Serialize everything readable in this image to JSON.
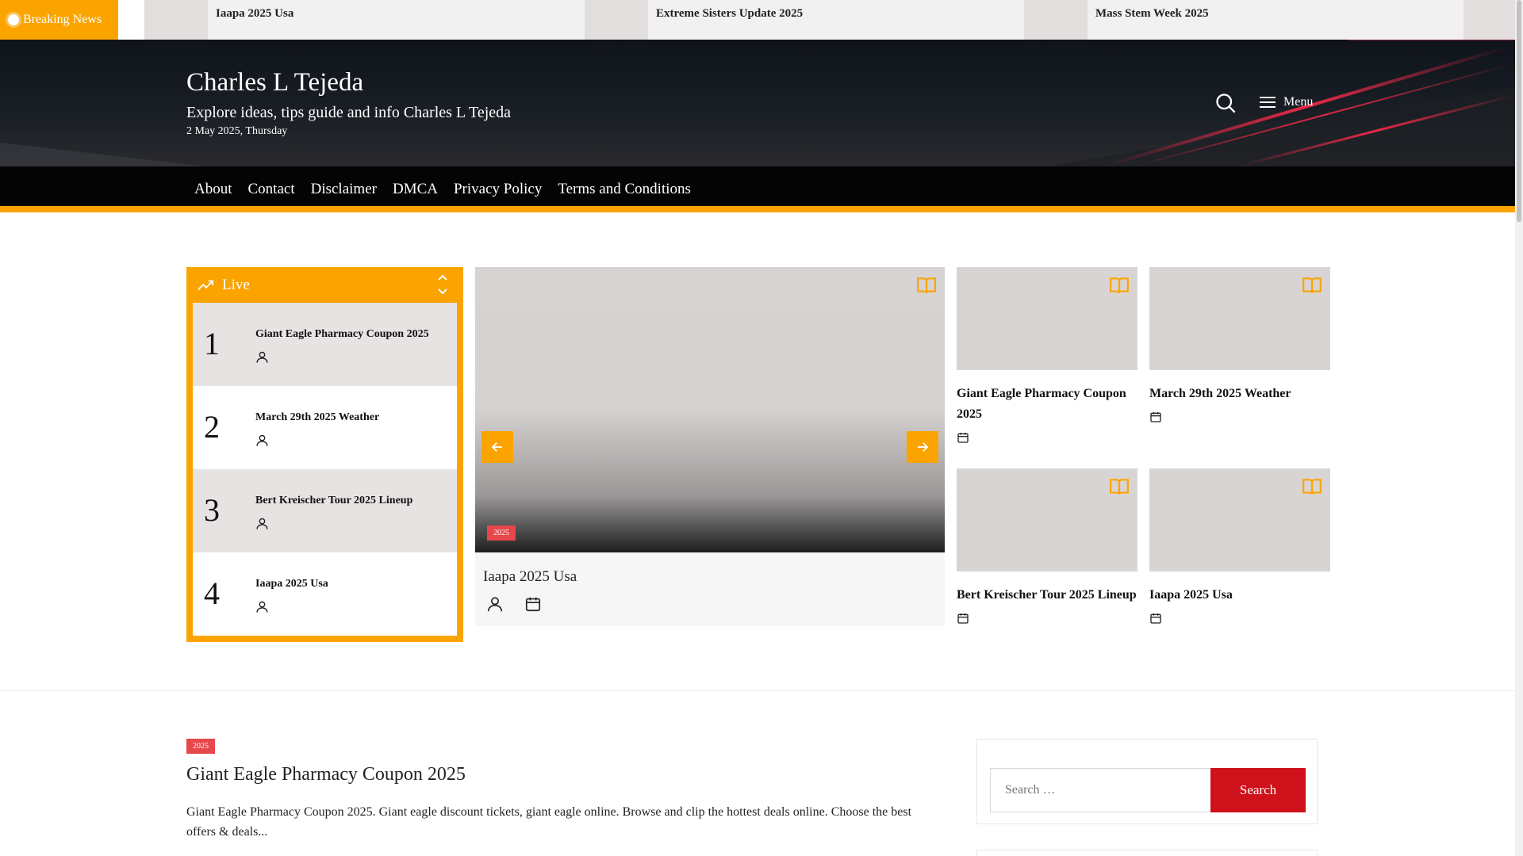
{
  "ticker": {
    "label": "Breaking News",
    "items": [
      "Iaapa 2025 Usa",
      "Extreme Sisters Update 2025",
      "Mass Stem Week 2025"
    ]
  },
  "header": {
    "site_title": "Charles L Tejeda",
    "tagline": "Explore ideas, tips guide and info Charles L Tejeda",
    "date": "2 May 2025, Thursday",
    "menu_label": "Menu"
  },
  "nav": {
    "items": [
      "About",
      "Contact",
      "Disclaimer",
      "DMCA",
      "Privacy Policy",
      "Terms and Conditions"
    ]
  },
  "live": {
    "label": "Live",
    "items": [
      {
        "num": "1",
        "title": "Giant Eagle Pharmacy Coupon 2025"
      },
      {
        "num": "2",
        "title": "March 29th 2025 Weather"
      },
      {
        "num": "3",
        "title": "Bert Kreischer Tour 2025 Lineup"
      },
      {
        "num": "4",
        "title": "Iaapa 2025 Usa"
      }
    ]
  },
  "featured": {
    "badge": "2025",
    "title": "Iaapa 2025 Usa"
  },
  "grid": [
    {
      "title": "Giant Eagle Pharmacy Coupon 2025"
    },
    {
      "title": "March 29th 2025 Weather"
    },
    {
      "title": "Bert Kreischer Tour 2025 Lineup"
    },
    {
      "title": "Iaapa 2025 Usa"
    }
  ],
  "post": {
    "badge": "2025",
    "title": "Giant Eagle Pharmacy Coupon 2025",
    "excerpt": "Giant Eagle Pharmacy Coupon 2025. Giant eagle discount tickets, giant eagle online. Browse and clip the hottest deals online. Choose the best offers & deals..."
  },
  "search_widget": {
    "placeholder": "Search …",
    "button_label": "Search"
  },
  "colors": {
    "accent": "#fba400",
    "badge": "#e6474b",
    "search_button": "#cf111b",
    "header_bg": "#14181e"
  }
}
